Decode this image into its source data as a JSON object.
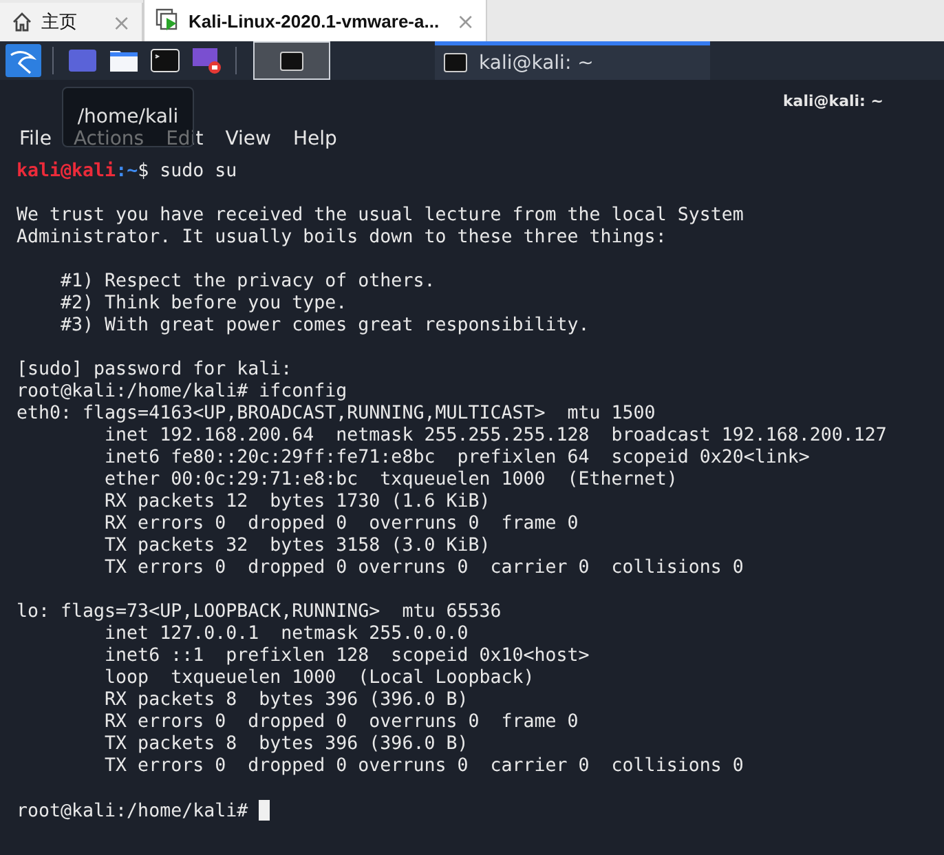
{
  "browser_tabs": [
    {
      "label": "主页",
      "kind": "home",
      "selected": false,
      "close": "×"
    },
    {
      "label": "Kali-Linux-2020.1-vmware-a...",
      "kind": "vm",
      "selected": true,
      "close": "×"
    }
  ],
  "panel": {
    "launchers": [
      {
        "kind": "desktop"
      },
      {
        "kind": "folder"
      },
      {
        "kind": "terminal"
      },
      {
        "kind": "recorder"
      }
    ],
    "workspaces": [
      {
        "selected": true
      }
    ],
    "windows": [
      {
        "label": "kali@kali: ~",
        "selected": true
      }
    ]
  },
  "window": {
    "title": "kali@kali: ~",
    "tooltip": "/home/kali",
    "menu": [
      "File",
      "Actions",
      "Edit",
      "View",
      "Help"
    ]
  },
  "terminal": {
    "lines": [
      {
        "kind": "user_prompt",
        "user": "kali@kali",
        "path": ":~",
        "symbol": "$",
        "command": " sudo su"
      },
      {
        "kind": "blank"
      },
      {
        "kind": "text",
        "text": "We trust you have received the usual lecture from the local System"
      },
      {
        "kind": "text",
        "text": "Administrator. It usually boils down to these three things:"
      },
      {
        "kind": "blank"
      },
      {
        "kind": "text",
        "text": "    #1) Respect the privacy of others."
      },
      {
        "kind": "text",
        "text": "    #2) Think before you type."
      },
      {
        "kind": "text",
        "text": "    #3) With great power comes great responsibility."
      },
      {
        "kind": "blank"
      },
      {
        "kind": "text",
        "text": "[sudo] password for kali:"
      },
      {
        "kind": "text",
        "text": "root@kali:/home/kali# ifconfig"
      },
      {
        "kind": "text",
        "text": "eth0: flags=4163<UP,BROADCAST,RUNNING,MULTICAST>  mtu 1500"
      },
      {
        "kind": "text",
        "text": "        inet 192.168.200.64  netmask 255.255.255.128  broadcast 192.168.200.127"
      },
      {
        "kind": "text",
        "text": "        inet6 fe80::20c:29ff:fe71:e8bc  prefixlen 64  scopeid 0x20<link>"
      },
      {
        "kind": "text",
        "text": "        ether 00:0c:29:71:e8:bc  txqueuelen 1000  (Ethernet)"
      },
      {
        "kind": "text",
        "text": "        RX packets 12  bytes 1730 (1.6 KiB)"
      },
      {
        "kind": "text",
        "text": "        RX errors 0  dropped 0  overruns 0  frame 0"
      },
      {
        "kind": "text",
        "text": "        TX packets 32  bytes 3158 (3.0 KiB)"
      },
      {
        "kind": "text",
        "text": "        TX errors 0  dropped 0 overruns 0  carrier 0  collisions 0"
      },
      {
        "kind": "blank"
      },
      {
        "kind": "text",
        "text": "lo: flags=73<UP,LOOPBACK,RUNNING>  mtu 65536"
      },
      {
        "kind": "text",
        "text": "        inet 127.0.0.1  netmask 255.0.0.0"
      },
      {
        "kind": "text",
        "text": "        inet6 ::1  prefixlen 128  scopeid 0x10<host>"
      },
      {
        "kind": "text",
        "text": "        loop  txqueuelen 1000  (Local Loopback)"
      },
      {
        "kind": "text",
        "text": "        RX packets 8  bytes 396 (396.0 B)"
      },
      {
        "kind": "text",
        "text": "        RX errors 0  dropped 0  overruns 0  frame 0"
      },
      {
        "kind": "text",
        "text": "        TX packets 8  bytes 396 (396.0 B)"
      },
      {
        "kind": "text",
        "text": "        TX errors 0  dropped 0 overruns 0  carrier 0  collisions 0"
      },
      {
        "kind": "blank"
      },
      {
        "kind": "cursor_prompt",
        "text": "root@kali:/home/kali# "
      }
    ]
  }
}
